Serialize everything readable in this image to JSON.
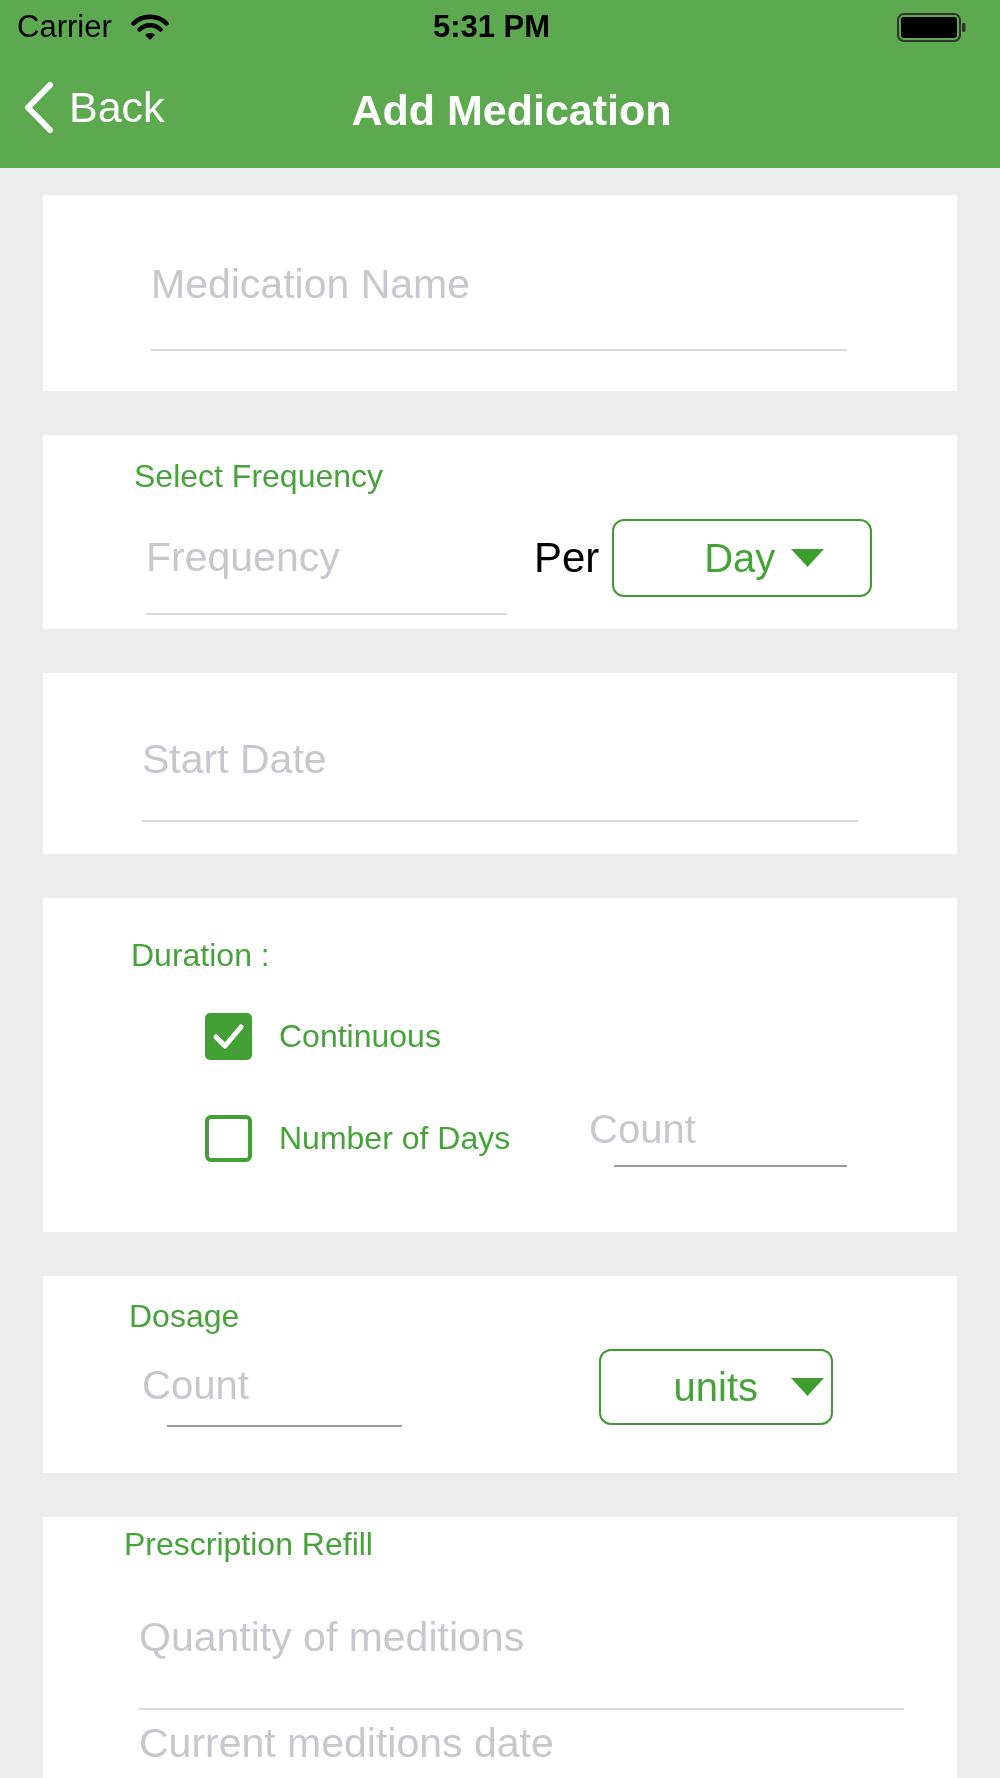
{
  "status_bar": {
    "carrier": "Carrier",
    "time": "5:31 PM"
  },
  "nav_bar": {
    "back": "Back",
    "title": "Add Medication"
  },
  "form": {
    "medication_name": {
      "placeholder": "Medication Name"
    },
    "frequency": {
      "label": "Select Frequency",
      "placeholder": "Frequency",
      "per": "Per",
      "unit": {
        "value": "Day"
      }
    },
    "start_date": {
      "placeholder": "Start Date"
    },
    "duration": {
      "label": "Duration :",
      "options": [
        {
          "label": "Continuous",
          "checked": true
        },
        {
          "label": "Number of Days",
          "checked": false,
          "count": {
            "placeholder": "Count"
          }
        }
      ]
    },
    "dosage": {
      "label": "Dosage",
      "placeholder": "Count",
      "unit": {
        "value": "units"
      }
    },
    "prescription_refill": {
      "label": "Prescription Refill",
      "fields": [
        {
          "placeholder": "Quantity of meditions"
        },
        {
          "placeholder": "Current meditions date"
        }
      ]
    }
  }
}
